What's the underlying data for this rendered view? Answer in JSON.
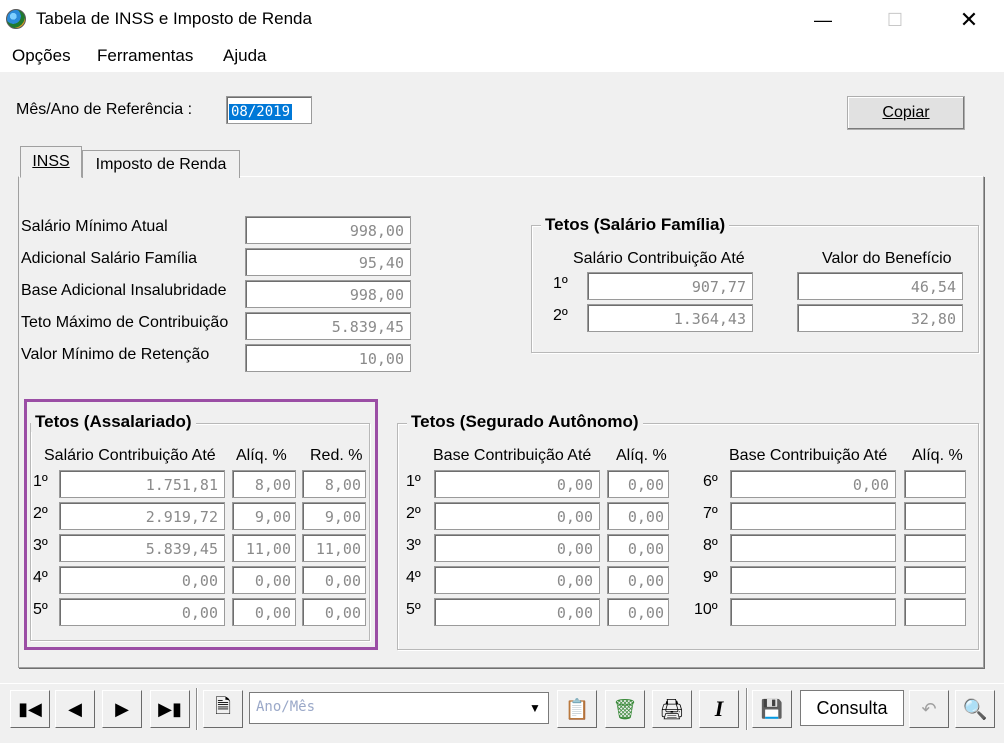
{
  "window": {
    "title": "Tabela de INSS e Imposto de Renda"
  },
  "menu": [
    "Opções",
    "Ferramentas",
    "Ajuda"
  ],
  "reference": {
    "label": "Mês/Ano de Referência :",
    "value": "08/2019"
  },
  "copy_button": "Copiar",
  "tabs": [
    "INSS",
    "Imposto de Renda"
  ],
  "basics": [
    {
      "label": "Salário Mínimo Atual",
      "value": "998,00"
    },
    {
      "label": "Adicional Salário Família",
      "value": "95,40"
    },
    {
      "label": "Base Adicional Insalubridade",
      "value": "998,00"
    },
    {
      "label": "Teto Máximo de Contribuição",
      "value": "5.839,45"
    },
    {
      "label": "Valor Mínimo de Retenção",
      "value": "10,00"
    }
  ],
  "familia": {
    "title": "Tetos (Salário Família)",
    "col1": "Salário Contribuição Até",
    "col2": "Valor do Benefício",
    "rows": [
      {
        "n": "1º",
        "a": "907,77",
        "b": "46,54"
      },
      {
        "n": "2º",
        "a": "1.364,43",
        "b": "32,80"
      }
    ]
  },
  "assalariado": {
    "title": "Tetos (Assalariado)",
    "col1": "Salário Contribuição Até",
    "col2": "Alíq. %",
    "col3": "Red. %",
    "rows": [
      {
        "n": "1º",
        "a": "1.751,81",
        "b": "8,00",
        "c": "8,00"
      },
      {
        "n": "2º",
        "a": "2.919,72",
        "b": "9,00",
        "c": "9,00"
      },
      {
        "n": "3º",
        "a": "5.839,45",
        "b": "11,00",
        "c": "11,00"
      },
      {
        "n": "4º",
        "a": "0,00",
        "b": "0,00",
        "c": "0,00"
      },
      {
        "n": "5º",
        "a": "0,00",
        "b": "0,00",
        "c": "0,00"
      }
    ]
  },
  "autonomo": {
    "title": "Tetos (Segurado Autônomo)",
    "col1": "Base Contribuição Até",
    "col2": "Alíq. %",
    "left": [
      {
        "n": "1º",
        "a": "0,00",
        "b": "0,00"
      },
      {
        "n": "2º",
        "a": "0,00",
        "b": "0,00"
      },
      {
        "n": "3º",
        "a": "0,00",
        "b": "0,00"
      },
      {
        "n": "4º",
        "a": "0,00",
        "b": "0,00"
      },
      {
        "n": "5º",
        "a": "0,00",
        "b": "0,00"
      }
    ],
    "right": [
      {
        "n": "6º",
        "a": "0,00",
        "b": ""
      },
      {
        "n": "7º",
        "a": "",
        "b": ""
      },
      {
        "n": "8º",
        "a": "",
        "b": ""
      },
      {
        "n": "9º",
        "a": "",
        "b": ""
      },
      {
        "n": "10º",
        "a": "",
        "b": ""
      }
    ]
  },
  "toolbar": {
    "combo_placeholder": "Ano/Mês",
    "mode": "Consulta"
  },
  "colors": {
    "highlight": "#9b4ea5",
    "selection": "#0078d7"
  }
}
